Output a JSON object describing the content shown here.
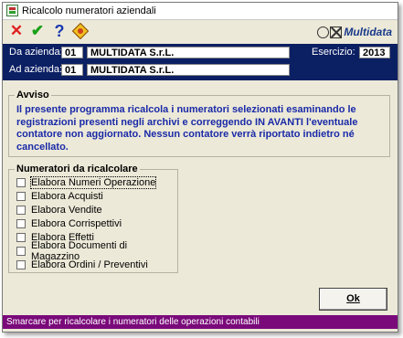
{
  "window": {
    "title": "Ricalcolo numeratori aziendali"
  },
  "toolbar": {
    "cancel_icon": "close-icon",
    "confirm_icon": "checkmark-icon",
    "help_icon": "help-icon",
    "tools_icon": "tool-icon",
    "logo_text": "Multidata"
  },
  "header": {
    "da_azienda_label": "Da azienda:",
    "da_azienda_code": "01",
    "da_azienda_name": "MULTIDATA S.r.L.",
    "ad_azienda_label": "Ad azienda:",
    "ad_azienda_code": "01",
    "ad_azienda_name": "MULTIDATA S.r.L.",
    "esercizio_label": "Esercizio:",
    "esercizio_value": "2013"
  },
  "avviso": {
    "legend": "Avviso",
    "text": "Il presente programma ricalcola i numeratori selezionati esaminando le registrazioni presenti negli archivi e correggendo IN AVANTI l'eventuale contatore non aggiornato. Nessun contatore verrà riportato indietro né cancellato."
  },
  "numeratori": {
    "legend": "Numeratori da ricalcolare",
    "items": [
      {
        "label": "Elabora Numeri Operazione",
        "checked": false
      },
      {
        "label": "Elabora Acquisti",
        "checked": false
      },
      {
        "label": "Elabora Vendite",
        "checked": false
      },
      {
        "label": "Elabora Corrispettivi",
        "checked": false
      },
      {
        "label": "Elabora Effetti",
        "checked": false
      },
      {
        "label": "Elabora Documenti di Magazzino",
        "checked": false
      },
      {
        "label": "Elabora Ordini / Preventivi",
        "checked": false
      }
    ]
  },
  "ok_button": {
    "label": "Ok"
  },
  "status": {
    "text": "Smarcare per ricalcolare i numeratori delle operazioni contabili"
  },
  "colors": {
    "header_bg": "#0b1f63",
    "status_bg": "#7a0a7a",
    "notice_text": "#1a2aa8"
  }
}
